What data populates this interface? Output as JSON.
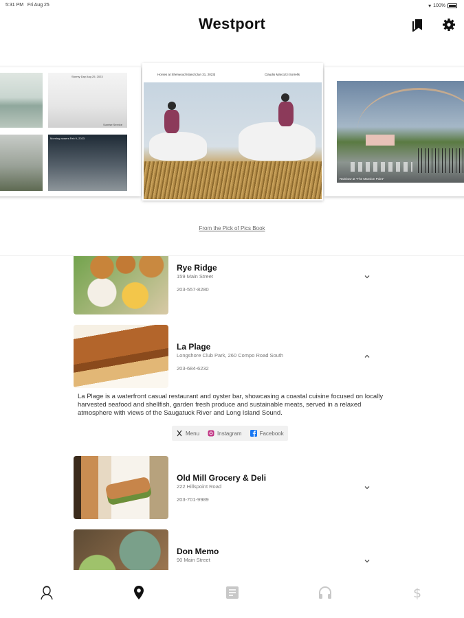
{
  "status_bar": {
    "time": "5:31 PM",
    "date": "Fri Aug 25",
    "battery": "100%"
  },
  "header": {
    "title": "Westport"
  },
  "carousel": {
    "left_card": {
      "caption_1": "Stormy Day Aug 25, 2023",
      "caption_2": "Sunrise Service",
      "caption_3": "Morning rowers Feb 9, 2023"
    },
    "center_card": {
      "caption_left": "Horses at Sherwood Island (Jan 31, 2023)",
      "caption_right": "Claudio Marcozzi Sorrells"
    },
    "right_card": {
      "caption": "Rainbow at \"The Mansion Point\""
    },
    "source_link": "From the Pick of Pics Book"
  },
  "restaurants": [
    {
      "name": "Rye Ridge",
      "address": "159 Main Street",
      "phone": "203-557-8280",
      "expanded": false
    },
    {
      "name": "La Plage",
      "address": "Longshore Club Park, 260 Compo Road South",
      "phone": "203-684-6232",
      "expanded": true,
      "description": "La Plage is a waterfront casual restaurant and oyster bar, showcasing a coastal cuisine focused on locally harvested seafood and shellfish, garden fresh produce and sustainable meats, served in a relaxed atmosphere with views of the Saugatuck River and Long Island Sound.",
      "links": {
        "menu": "Menu",
        "instagram": "Instagram",
        "facebook": "Facebook"
      }
    },
    {
      "name": "Old Mill Grocery & Deli",
      "address": "222 Hillspoint Road",
      "phone": "203-701-9989",
      "expanded": false
    },
    {
      "name": "Don Memo",
      "address": "90 Main Street",
      "phone": "",
      "expanded": false
    }
  ],
  "tabs": [
    {
      "icon": "portrait-icon",
      "active": false
    },
    {
      "icon": "map-pin-icon",
      "active": true
    },
    {
      "icon": "article-icon",
      "active": false
    },
    {
      "icon": "headphones-icon",
      "active": false
    },
    {
      "icon": "dollar-icon",
      "active": false
    }
  ],
  "colors": {
    "active_tab": "#111111",
    "inactive_tab": "#c8c8c8",
    "instagram": "#c13584",
    "facebook": "#1877f2"
  }
}
